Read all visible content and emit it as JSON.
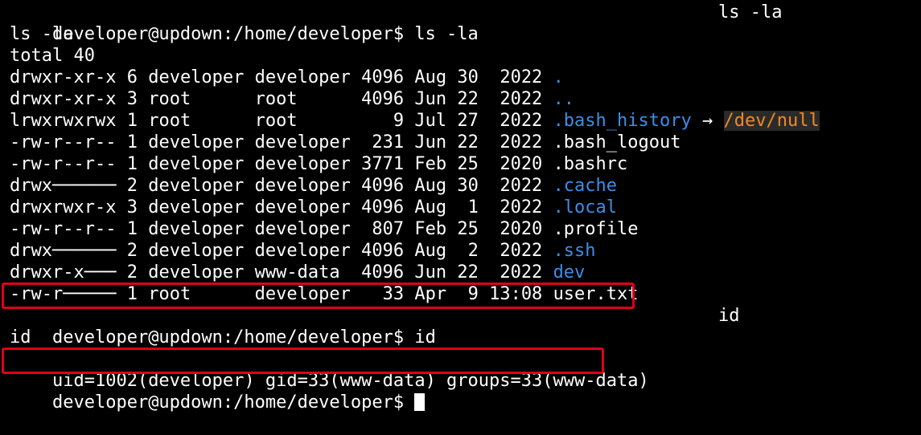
{
  "terminal": {
    "prompt_ls": "developer@updown:/home/developer$ ls -la",
    "prompt_ls_echo": "ls -la",
    "ls_echo_line": "ls -la",
    "total": "total 40",
    "listing": [
      {
        "perm": "drwxr-xr-x",
        "links": "6",
        "owner": "developer",
        "group": "developer",
        "size": "4096",
        "month": "Aug",
        "day": "30",
        "time": " 2022",
        "name": ".",
        "type": "dir",
        "link_target": ""
      },
      {
        "perm": "drwxr-xr-x",
        "links": "3",
        "owner": "root",
        "group": "root",
        "size": "4096",
        "month": "Jun",
        "day": "22",
        "time": " 2022",
        "name": "..",
        "type": "dir",
        "link_target": ""
      },
      {
        "perm": "lrwxrwxrwx",
        "links": "1",
        "owner": "root",
        "group": "root",
        "size": "9",
        "month": "Jul",
        "day": "27",
        "time": " 2022",
        "name": ".bash_history",
        "type": "link",
        "link_target": "/dev/null"
      },
      {
        "perm": "-rw-r--r--",
        "links": "1",
        "owner": "developer",
        "group": "developer",
        "size": "231",
        "month": "Jun",
        "day": "22",
        "time": " 2022",
        "name": ".bash_logout",
        "type": "file",
        "link_target": ""
      },
      {
        "perm": "-rw-r--r--",
        "links": "1",
        "owner": "developer",
        "group": "developer",
        "size": "3771",
        "month": "Feb",
        "day": "25",
        "time": " 2020",
        "name": ".bashrc",
        "type": "file",
        "link_target": ""
      },
      {
        "perm": "drwx──────",
        "links": "2",
        "owner": "developer",
        "group": "developer",
        "size": "4096",
        "month": "Aug",
        "day": "30",
        "time": " 2022",
        "name": ".cache",
        "type": "dir",
        "link_target": ""
      },
      {
        "perm": "drwxrwxr-x",
        "links": "3",
        "owner": "developer",
        "group": "developer",
        "size": "4096",
        "month": "Aug",
        "day": "1",
        "time": " 2022",
        "name": ".local",
        "type": "dir",
        "link_target": ""
      },
      {
        "perm": "-rw-r--r--",
        "links": "1",
        "owner": "developer",
        "group": "developer",
        "size": "807",
        "month": "Feb",
        "day": "25",
        "time": " 2020",
        "name": ".profile",
        "type": "file",
        "link_target": ""
      },
      {
        "perm": "drwx──────",
        "links": "2",
        "owner": "developer",
        "group": "developer",
        "size": "4096",
        "month": "Aug",
        "day": "2",
        "time": " 2022",
        "name": ".ssh",
        "type": "dir",
        "link_target": ""
      },
      {
        "perm": "drwxr-x───",
        "links": "2",
        "owner": "developer",
        "group": "www-data",
        "size": "4096",
        "month": "Jun",
        "day": "22",
        "time": " 2022",
        "name": "dev",
        "type": "dir",
        "link_target": ""
      },
      {
        "perm": "-rw-r─────",
        "links": "1",
        "owner": "root",
        "group": "developer",
        "size": "33",
        "month": "Apr",
        "day": "9",
        "time": "13:08",
        "name": "user.txt",
        "type": "file",
        "link_target": "",
        "highlighted": true
      }
    ],
    "prompt_id": "developer@updown:/home/developer$ id",
    "prompt_id_echo": "id",
    "id_echo_line": "id",
    "id_output": "uid=1002(developer) gid=33(www-data) groups=33(www-data)",
    "prompt_final": "developer@updown:/home/developer$ ",
    "arrow_glyph": "→",
    "colors": {
      "background": "#000000",
      "foreground": "#ffffff",
      "directory": "#3b8eea",
      "link_target": "#f08a24",
      "highlight_box": "#e0001b"
    }
  }
}
